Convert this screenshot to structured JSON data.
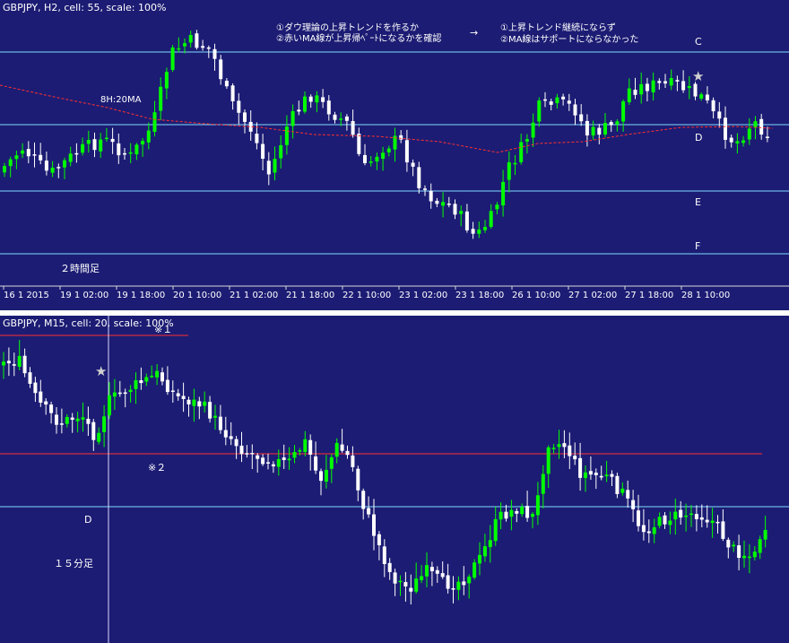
{
  "top_chart": {
    "header": "GBPJPY, H2, cell: 55, scale: 100%",
    "annotation_left_line1": "①ダウ理論の上昇トレンドを作るか",
    "annotation_left_line2": "②赤いMA線が上昇帰ﾍﾟｰﾄになるかを確認",
    "arrow": "→",
    "annotation_right_line1": "①上昇トレンド継続にならず",
    "annotation_right_line2": "②MA線はサポートにならなかった",
    "ma_label": "8H:20MA",
    "timeframe_label": "２時間足",
    "level_labels": [
      "C",
      "D",
      "E",
      "F"
    ],
    "star": "★",
    "colors": {
      "background": "#1c1c74",
      "bull": "#00ff00",
      "bear": "#ffffff",
      "level_line": "#7fdcff",
      "ma": "#ff3030",
      "grid": "#d8d8d8"
    }
  },
  "bottom_chart": {
    "header": "GBPJPY, M15, cell: 20, scale: 100%",
    "note1": "※１",
    "note2": "※２",
    "level_label": "D",
    "timeframe_label": "１５分足",
    "star": "★",
    "colors": {
      "background": "#1c1c74",
      "bull": "#00ff00",
      "bear": "#ffffff",
      "level_line": "#7fdcff",
      "red_line": "#ff3030",
      "crosshair": "#d8d8ff"
    }
  },
  "chart_data": [
    {
      "type": "candlestick",
      "title": "GBPJPY, H2, cell: 55, scale: 100%",
      "x_tick_labels": [
        "16 1 2015",
        "19 1 02:00",
        "19 1 18:00",
        "20 1 10:00",
        "21 1 02:00",
        "21 1 18:00",
        "22 1 10:00",
        "23 1 02:00",
        "23 1 18:00",
        "26 1 10:00",
        "27 1 02:00",
        "27 1 18:00",
        "28 1 10:00"
      ],
      "horizontal_levels": [
        "C",
        "D",
        "E",
        "F"
      ],
      "series": [
        {
          "name": "8H:20MA",
          "style": "dashed red"
        }
      ],
      "grid": false
    },
    {
      "type": "candlestick",
      "title": "GBPJPY, M15, cell: 20, scale: 100%",
      "horizontal_levels": [
        "D"
      ],
      "grid": false
    }
  ]
}
